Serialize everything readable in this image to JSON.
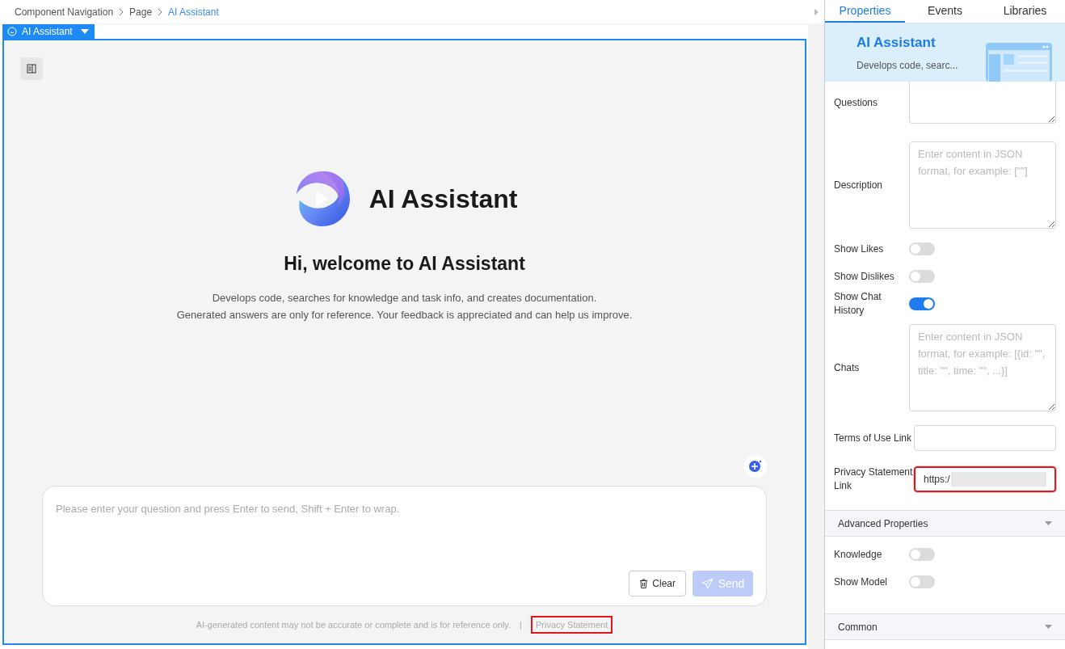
{
  "breadcrumb": [
    {
      "label": "Component Navigation",
      "selected": false
    },
    {
      "label": "Page",
      "selected": false
    },
    {
      "label": "AI Assistant",
      "selected": true
    }
  ],
  "component_tag": {
    "label": "AI Assistant"
  },
  "assistant": {
    "title": "AI Assistant",
    "greeting": "Hi, welcome to AI Assistant",
    "description": [
      "Develops code, searches for knowledge and task info, and creates documentation.",
      "Generated answers are only for reference. Your feedback is appreciated and can help us improve."
    ],
    "input": {
      "placeholder": "Please enter your question and press Enter to send, Shift + Enter to wrap."
    },
    "buttons": [
      {
        "kind": "clear",
        "label": "Clear",
        "disabled": false
      },
      {
        "kind": "send",
        "label": "Send",
        "disabled": true
      }
    ],
    "disclaimer": "AI-generated content may not be accurate or complete and is for reference only.",
    "separator": "|",
    "privacy_link": {
      "label": "Privacy Statement",
      "highlighted": true
    }
  },
  "panel": {
    "tabs": [
      {
        "label": "Properties",
        "selected": true
      },
      {
        "label": "Events",
        "selected": false
      },
      {
        "label": "Libraries",
        "selected": false
      }
    ],
    "header": {
      "title": "AI Assistant",
      "subtitle": "Develops code, searc..."
    },
    "fields": [
      {
        "kind": "textarea",
        "label": "Questions",
        "cut": true
      },
      {
        "kind": "textarea",
        "label": "Description",
        "placeholder": "Enter content in JSON format, for example: [\"\"]"
      },
      {
        "kind": "toggle",
        "label": "Show Likes",
        "on": false
      },
      {
        "kind": "toggle",
        "label": "Show Dislikes",
        "on": false
      },
      {
        "kind": "toggle",
        "label": "Show Chat History",
        "on": true
      },
      {
        "kind": "textarea",
        "label": "Chats",
        "placeholder": "Enter content in JSON format, for example: [{id: \"\", title: \"\", time: \"\", ...}]"
      },
      {
        "kind": "input",
        "label": "Terms of Use Link",
        "highlighted": false
      },
      {
        "kind": "input",
        "label": "Privacy Statement Link",
        "value": "https:/",
        "blurred": true,
        "highlighted": true
      }
    ],
    "sections": [
      {
        "title": "Advanced Properties",
        "fields": [
          {
            "kind": "toggle",
            "label": "Knowledge",
            "on": false
          },
          {
            "kind": "toggle",
            "label": "Show Model",
            "on": false
          }
        ]
      },
      {
        "title": "Common"
      }
    ]
  }
}
